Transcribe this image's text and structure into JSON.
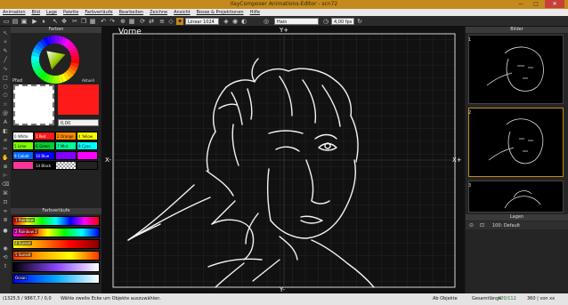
{
  "window": {
    "title": "IlayComposer Animations-Editor - scn72",
    "btn_minimize": "—",
    "btn_maximize": "□",
    "btn_close": "✕"
  },
  "menu": [
    "Animation",
    "Bild",
    "Lage",
    "Palette",
    "Farbverläufe",
    "Bearbeiten",
    "Zeichne",
    "Ansicht",
    "Bosse & Projektionen",
    "Hilfe"
  ],
  "toolbar": {
    "mode_value": "Linear 1024",
    "color_value": "Hain",
    "fps_value": "4,00 fps"
  },
  "farben": {
    "header": "Farben",
    "fill_label": "Pfad",
    "outline_label": "Aktuell",
    "value": "0,00",
    "fill_color": "#ffffff",
    "outline_color": "#ff1a1a"
  },
  "palette": [
    {
      "label": "0 White",
      "color": "#ffffff",
      "text": "#000000"
    },
    {
      "label": "1 Red",
      "color": "#ff1a1a",
      "text": "#ffffff"
    },
    {
      "label": "2 Orange",
      "color": "#ff8a00",
      "text": "#000000"
    },
    {
      "label": "4 Yellow",
      "color": "#ffff00",
      "text": "#000000"
    },
    {
      "label": "5 Lime",
      "color": "#7fff00",
      "text": "#000000"
    },
    {
      "label": "6 Green",
      "color": "#00cc33",
      "text": "#000000"
    },
    {
      "label": "7 Mint",
      "color": "#00ff99",
      "text": "#000000"
    },
    {
      "label": "8 Cyan",
      "color": "#00ffff",
      "text": "#000000"
    },
    {
      "label": "9 Cobalt",
      "color": "#0066ff",
      "text": "#ffffff"
    },
    {
      "label": "10 Blue",
      "color": "#0000ff",
      "text": "#ffffff"
    },
    {
      "label": "",
      "color": "#8000ff",
      "text": "#ffffff"
    },
    {
      "label": "",
      "color": "#ff00ff",
      "text": "#ffffff"
    },
    {
      "label": "",
      "color": "#ff3399",
      "text": "#ffffff"
    },
    {
      "label": "14 Black",
      "color": "#000000",
      "text": "#ffffff"
    },
    {
      "label": "",
      "color": "checker",
      "text": "#000000"
    },
    {
      "label": "",
      "color": "#222222",
      "text": "#ffffff"
    }
  ],
  "gradients": {
    "header": "Farbverläufe",
    "items": [
      {
        "label": "1 Rainbow",
        "css": "linear-gradient(90deg,#ff0000,#ffff00,#00ff00,#00ffff,#0000ff,#ff00ff,#ff0000)"
      },
      {
        "label": "2 Rainbow 2",
        "css": "linear-gradient(90deg,#ff00ff,#ff0000,#ffff00,#00ff00,#00ffff,#0000ff)"
      },
      {
        "label": "4 Sunset",
        "css": "linear-gradient(90deg,#ffff00,#ff8800,#ff0000,#880000)"
      },
      {
        "label": "5 Sunset",
        "css": "linear-gradient(90deg,#ff3300,#ffaa00,#ffff00,#ff3300)"
      },
      {
        "label": "",
        "css": "linear-gradient(90deg,#000000,#8844ff,#ffffff)"
      },
      {
        "label": "Ocean",
        "css": "linear-gradient(90deg,#0000ff,#00aaff,#ffffff)"
      }
    ]
  },
  "canvas": {
    "view_name": "Vorne",
    "top_label": "Y+",
    "bottom_label": "Y-",
    "left_label": "X-",
    "right_label": "X+"
  },
  "bilder": {
    "header": "Bilder",
    "thumbs": [
      "1",
      "2",
      "3"
    ]
  },
  "lagen": {
    "header": "Lagen",
    "layer_name": "100: Default"
  },
  "status": {
    "coords": "(1325,5 / 9867,7 / 0,0",
    "hint": "Wähle zweite Ecke um Objekte auszuwählen.",
    "objects": "Ab Objekte",
    "length_label": "Gesamtlänge:",
    "length_value": "470/112",
    "pts": "360 | von xx"
  }
}
